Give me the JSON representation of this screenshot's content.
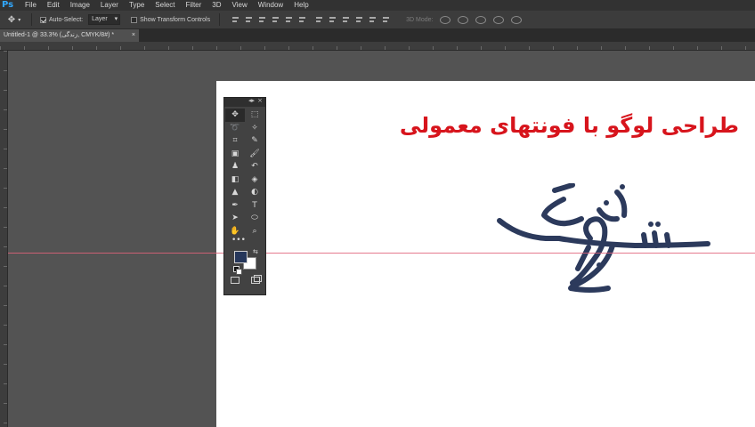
{
  "app": {
    "logo": "Ps"
  },
  "menu": [
    "File",
    "Edit",
    "Image",
    "Layer",
    "Type",
    "Select",
    "Filter",
    "3D",
    "View",
    "Window",
    "Help"
  ],
  "options": {
    "auto_select_label": "Auto-Select:",
    "auto_select_checked": true,
    "auto_select_target": "Layer",
    "transform_controls_label": "Show Transform Controls",
    "transform_controls_checked": false,
    "mode_3d_label": "3D Mode:"
  },
  "document": {
    "tab_title": "Untitled-1 @ 33.3% (زندگی, CMYK/8#) *",
    "tab_close": "×"
  },
  "canvas": {
    "headline": "طراحی لوگو با فونتهای معمولی",
    "headline_color": "#d7141c",
    "logo_color": "#2c3a5c"
  },
  "tools_panel": {
    "collapse_glyph": "◂▸",
    "close_glyph": "×",
    "tools": [
      {
        "name": "move-tool-icon",
        "glyph": "✥",
        "active": true
      },
      {
        "name": "marquee-tool-icon",
        "glyph": "⬚",
        "active": false
      },
      {
        "name": "lasso-tool-icon",
        "glyph": "➰",
        "active": false
      },
      {
        "name": "magic-wand-tool-icon",
        "glyph": "✧",
        "active": false
      },
      {
        "name": "crop-tool-icon",
        "glyph": "⌗",
        "active": false
      },
      {
        "name": "eyedropper-tool-icon",
        "glyph": "✎",
        "active": false
      },
      {
        "name": "healing-brush-tool-icon",
        "glyph": "▣",
        "active": false
      },
      {
        "name": "brush-tool-icon",
        "glyph": "🖌",
        "active": false
      },
      {
        "name": "clone-stamp-tool-icon",
        "glyph": "♟",
        "active": false
      },
      {
        "name": "history-brush-tool-icon",
        "glyph": "↶",
        "active": false
      },
      {
        "name": "eraser-tool-icon",
        "glyph": "◧",
        "active": false
      },
      {
        "name": "paint-bucket-tool-icon",
        "glyph": "◈",
        "active": false
      },
      {
        "name": "sharpen-tool-icon",
        "glyph": "▲",
        "active": false
      },
      {
        "name": "dodge-tool-icon",
        "glyph": "◐",
        "active": false
      },
      {
        "name": "pen-tool-icon",
        "glyph": "✒",
        "active": false
      },
      {
        "name": "type-tool-icon",
        "glyph": "T",
        "active": false
      },
      {
        "name": "path-selection-tool-icon",
        "glyph": "➤",
        "active": false
      },
      {
        "name": "ellipse-tool-icon",
        "glyph": "⬭",
        "active": false
      },
      {
        "name": "hand-tool-icon",
        "glyph": "✋",
        "active": false
      },
      {
        "name": "zoom-tool-icon",
        "glyph": "⌕",
        "active": false
      }
    ],
    "more_tools": "•••",
    "foreground_color": "#26375b",
    "background_color": "#ffffff",
    "swap_glyph": "⇆"
  }
}
